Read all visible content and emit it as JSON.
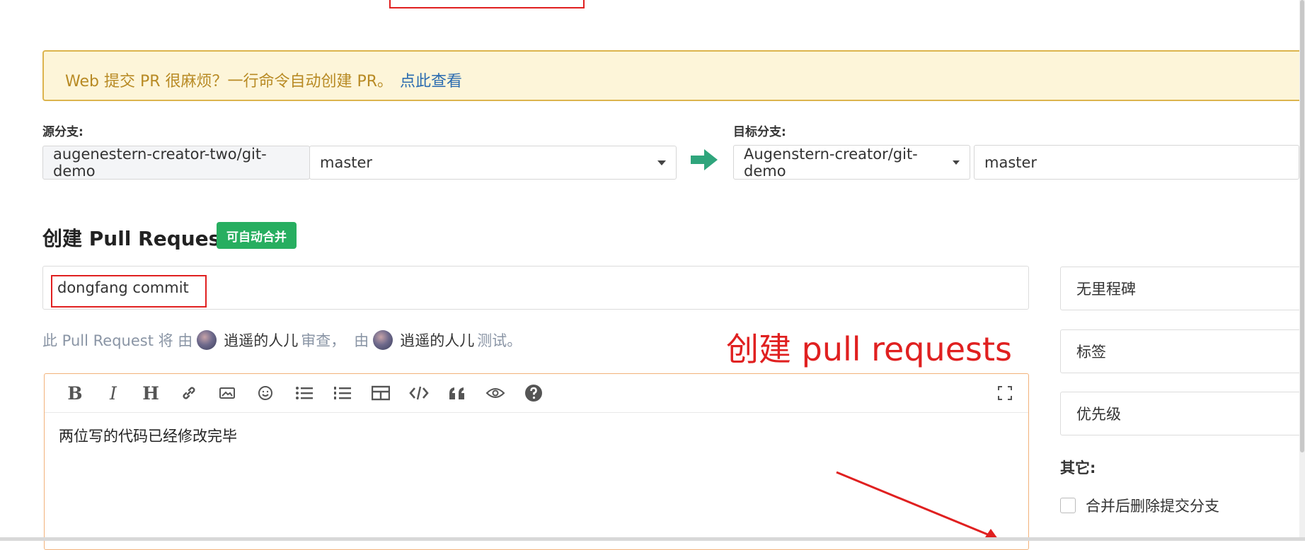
{
  "notice": {
    "text": "Web 提交 PR 很麻烦？一行命令自动创建 PR。",
    "link": "点此查看"
  },
  "source": {
    "label": "源分支:",
    "repo": "augenestern-creator-two/git-demo",
    "branch": "master"
  },
  "target": {
    "label": "目标分支:",
    "repo": "Augenstern-creator/git-demo",
    "branch": "master"
  },
  "pr": {
    "heading": "创建 Pull Request",
    "badge": "可自动合并",
    "title_value": "dongfang commit",
    "reviewer": {
      "prefix": "此 Pull Request 将 由",
      "reviewer_name": "逍遥的人儿",
      "review_word": "审查，",
      "by": "由",
      "tester_name": "逍遥的人儿",
      "test_word": "测试。"
    },
    "body": "两位写的代码已经修改完毕"
  },
  "annotation": {
    "text": "创建 pull requests",
    "color": "#e02020"
  },
  "toolbar": {
    "icons": [
      "bold-icon",
      "italic-icon",
      "heading-icon",
      "link-icon",
      "image-icon",
      "emoji-icon",
      "bullet-list-icon",
      "numbered-list-icon",
      "table-icon",
      "code-icon",
      "quote-icon",
      "preview-icon",
      "help-icon",
      "fullscreen-icon"
    ],
    "bold": "B",
    "italic": "I",
    "heading": "H"
  },
  "sidebar": {
    "milestone": "无里程碑",
    "labels": "标签",
    "priority": "优先级",
    "other_label": "其它:",
    "delete_branch": "合并后删除提交分支"
  },
  "colors": {
    "merge_badge": "#27ae60",
    "notice_bg": "#fdf5d9",
    "arrow": "#2fa57c",
    "accent_red": "#e02020"
  }
}
